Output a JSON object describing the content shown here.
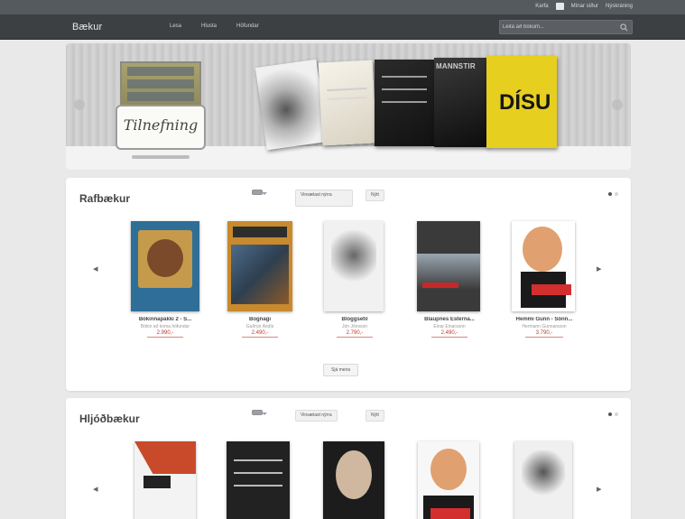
{
  "top_bar": {
    "cart_label": "Karfa",
    "login_label": "Mínar síður",
    "register_label": "Nýskráning"
  },
  "nav": {
    "logo": "Bækur",
    "links": [
      "Lesa",
      "Hlusta",
      "Höfundar"
    ],
    "search_placeholder": "Leita að bókum..."
  },
  "hero": {
    "badge_script": "Tilnefning",
    "book_word_1": "MANNSTIR",
    "book_word_2": "DÍSU"
  },
  "sections": [
    {
      "title": "Rafbækur",
      "filter_tab": "",
      "filters": [
        "Vinsælast nýrra",
        "Nýtt"
      ],
      "see_more": "Sjá meira",
      "books": [
        {
          "title": "Bókinnapakki 2 - S...",
          "author": "Bókin að koma höfundur",
          "price": "2.990,-",
          "cover": "#2f6f97"
        },
        {
          "title": "Bognagi",
          "author": "Guðrún Ásdís",
          "price": "2.490,-",
          "cover": "#c88a2c"
        },
        {
          "title": "Bloggsetil",
          "author": "Jón Jónsson",
          "price": "2.790,-",
          "cover": "#f1f1f1"
        },
        {
          "title": "Blaupnes Esterna...",
          "author": "Einar Einarsson",
          "price": "2.490,-",
          "cover": "#3a3a3a"
        },
        {
          "title": "Hemmi Gunn - Sönn...",
          "author": "Hermann Gunnarsson",
          "price": "3.790,-",
          "cover": "#ffffff"
        }
      ]
    },
    {
      "title": "Hljóðbækur",
      "filter_tab": "",
      "filters": [
        "Vinsælast nýrra",
        "Nýtt"
      ],
      "books": [
        {
          "cover": "#f3f3f3"
        },
        {
          "cover": "#222222"
        },
        {
          "cover": "#1c1c1c"
        },
        {
          "cover": "#f7f7f7"
        },
        {
          "cover": "#f0f0f0"
        }
      ]
    }
  ],
  "icons": {
    "search": "magnifier-icon",
    "prev": "chevron-left-icon",
    "next": "chevron-right-icon",
    "cart": "cart-icon"
  }
}
